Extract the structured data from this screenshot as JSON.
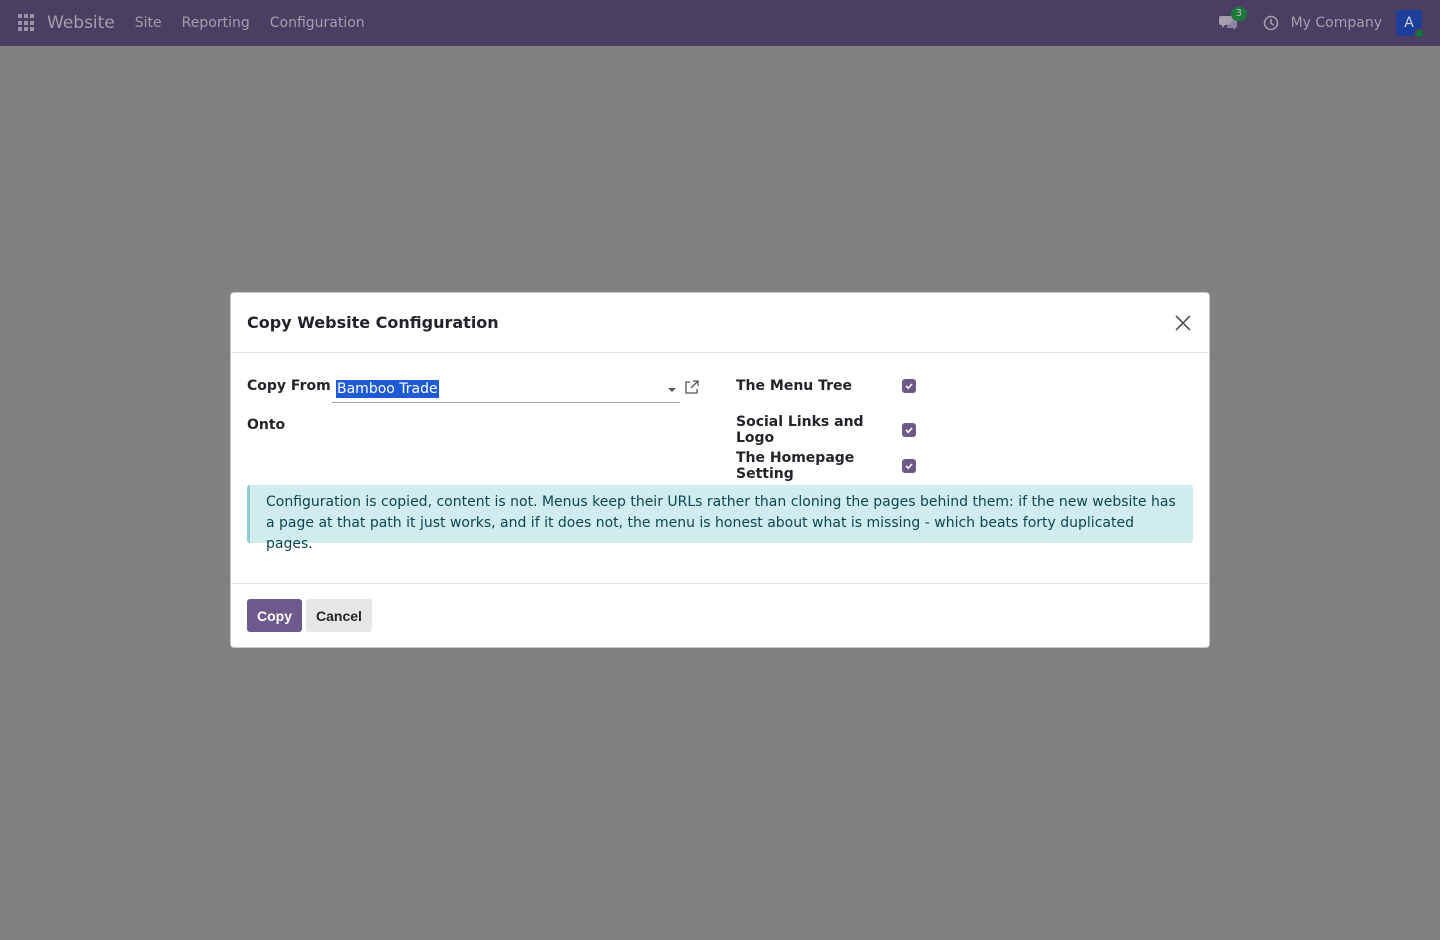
{
  "navbar": {
    "brand": "Website",
    "menu": [
      "Site",
      "Reporting",
      "Configuration"
    ],
    "chat_count": "3",
    "company": "My Company",
    "avatar_letter": "A"
  },
  "dialog": {
    "title": "Copy Website Configuration",
    "copy_from_label": "Copy From",
    "copy_from_value": "Bamboo Trade",
    "onto_label": "Onto",
    "options": [
      {
        "label": "The Menu Tree",
        "checked": true
      },
      {
        "label": "Social Links and Logo",
        "checked": true
      },
      {
        "label": "The Homepage Setting",
        "checked": true
      }
    ],
    "info": "Configuration is copied, content is not. Menus keep their URLs rather than cloning the pages behind them: if the new website has a page at that path it just works, and if it does not, the menu is honest about what is missing - which beats forty duplicated pages.",
    "copy_button": "Copy",
    "cancel_button": "Cancel"
  },
  "colors": {
    "navbar": "#4b3e63",
    "primary": "#6c5a8d",
    "info_bg": "#d1ecef",
    "backdrop": "#808080"
  }
}
